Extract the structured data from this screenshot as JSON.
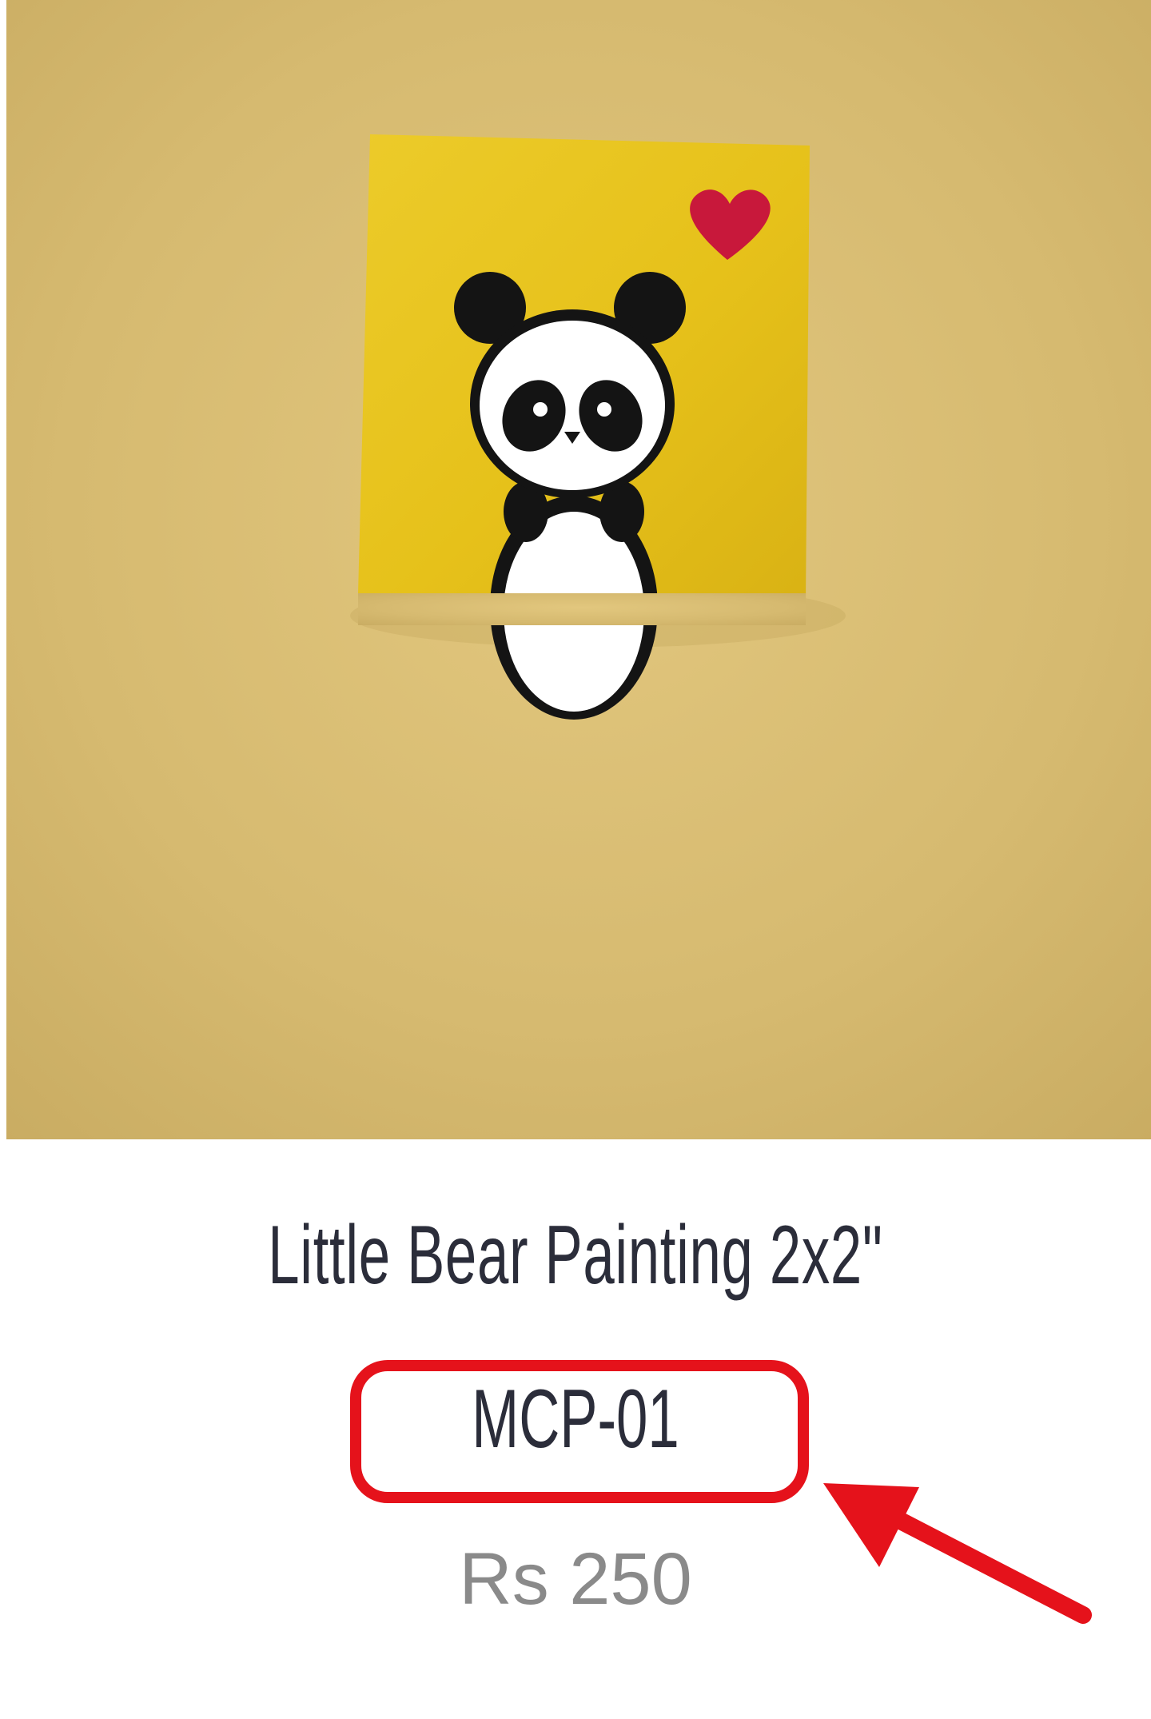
{
  "product": {
    "title": "Little Bear Painting 2x2\"",
    "sku": "MCP-01",
    "price": "Rs 250",
    "image_subject": "panda-painting"
  },
  "colors": {
    "background_photo": "#d8bd74",
    "canvas_yellow": "#e9c51f",
    "heart_red": "#c8183b",
    "title_text": "#2b2d3a",
    "price_text": "#8a8a8a",
    "highlight_red": "#e5121b"
  },
  "annotation": {
    "highlight_target": "product-sku",
    "shapes": [
      "rounded-rectangle-highlight",
      "arrow-pointer"
    ]
  }
}
